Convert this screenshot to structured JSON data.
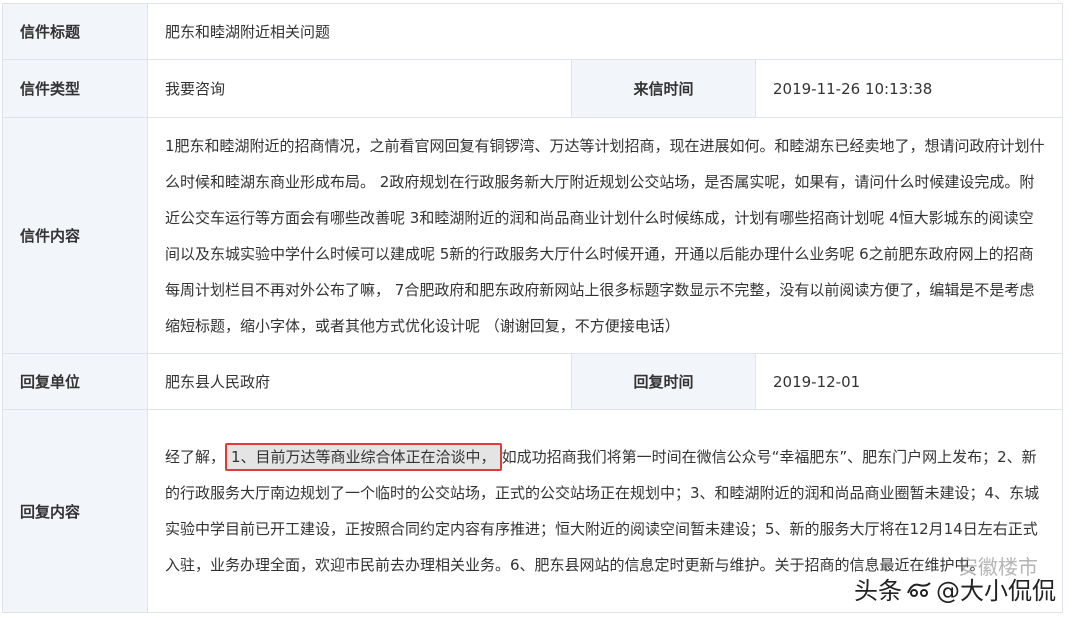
{
  "row1": {
    "label": "信件标题",
    "value": "肥东和睦湖附近相关问题"
  },
  "row2": {
    "type_label": "信件类型",
    "type_value": "我要咨询",
    "time_label": "来信时间",
    "time_value": "2019-11-26 10:13:38"
  },
  "row3": {
    "label": "信件内容",
    "value": "1肥东和睦湖附近的招商情况，之前看官网回复有铜锣湾、万达等计划招商，现在进展如何。和睦湖东已经卖地了，想请问政府计划什么时候和睦湖东商业形成布局。 2政府规划在行政服务新大厅附近规划公交站场，是否属实呢，如果有，请问什么时候建设完成。附近公交车运行等方面会有哪些改善呢 3和睦湖附近的润和尚品商业计划什么时候练成，计划有哪些招商计划呢 4恒大影城东的阅读空间以及东城实验中学什么时候可以建成呢 5新的行政服务大厅什么时候开通，开通以后能办理什么业务呢 6之前肥东政府网上的招商每周计划栏目不再对外公布了嘛， 7合肥政府和肥东政府新网站上很多标题字数显示不完整，没有以前阅读方便了，编辑是不是考虑缩短标题，缩小字体，或者其他方式优化设计呢 （谢谢回复，不方便接电话）"
  },
  "row4": {
    "unit_label": "回复单位",
    "unit_value": "肥东县人民政府",
    "time_label": "回复时间",
    "time_value": "2019-12-01"
  },
  "row5": {
    "label": "回复内容",
    "prefix": "经了解，",
    "highlighted": "1、目前万达等商业综合体正在洽谈中，",
    "rest": "如成功招商我们将第一时间在微信公众号“幸福肥东”、肥东门户网上发布；2、新的行政服务大厅南边规划了一个临时的公交站场，正式的公交站场正在规划中；3、和睦湖附近的润和尚品商业圈暂未建设；4、东城实验中学目前已开工建设，正按照合同约定内容有序推进；恒大附近的阅读空间暂未建设；5、新的服务大厅将在12月14日左右正式入驻，业务办理全面，欢迎市民前去办理相关业务。6、肥东县网站的信息定时更新与维护。关于招商的信息最近在维护中。"
  },
  "watermark": {
    "faint": "安徽楼市",
    "main_prefix": "头条",
    "main_handle": "@大小侃侃"
  }
}
